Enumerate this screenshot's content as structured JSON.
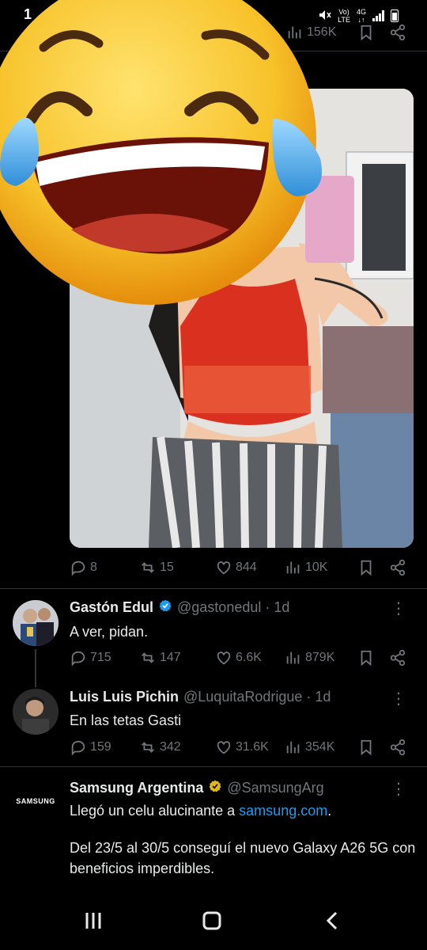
{
  "status": {
    "time": "1",
    "network_label": "Vo) 4G\nLTE",
    "icons": [
      "mute-icon",
      "volte-icon",
      "signal-icon",
      "battery-icon"
    ]
  },
  "top_post": {
    "views": "156K"
  },
  "post_main": {
    "replies": "8",
    "retweets": "15",
    "likes": "844",
    "views": "10K"
  },
  "tweets": [
    {
      "name": "Gastón Edul",
      "handle": "@gastonedul · 1d",
      "verified": "blue",
      "text": "A ver, pidan.",
      "replies": "715",
      "retweets": "147",
      "likes": "6.6K",
      "views": "879K"
    },
    {
      "name": "Luis Luis Pichin",
      "handle": "@LuquitaRodrigue · 1d",
      "text": "En las tetas Gasti",
      "replies": "159",
      "retweets": "342",
      "likes": "31.6K",
      "views": "354K"
    },
    {
      "name": "Samsung Argentina",
      "handle": "@SamsungArg",
      "verified": "gold",
      "text_prefix": "Llegó un celu alucinante a ",
      "text_link": "samsung.com",
      "text_suffix": ".",
      "text2": "Del 23/5 al 30/5 conseguí el nuevo Galaxy A26 5G con beneficios imperdibles.",
      "avatar_text": "SAMSUNG"
    }
  ],
  "colors": {
    "accent": "#1d9bf0",
    "muted": "#71767b",
    "gold": "#e2b719"
  }
}
